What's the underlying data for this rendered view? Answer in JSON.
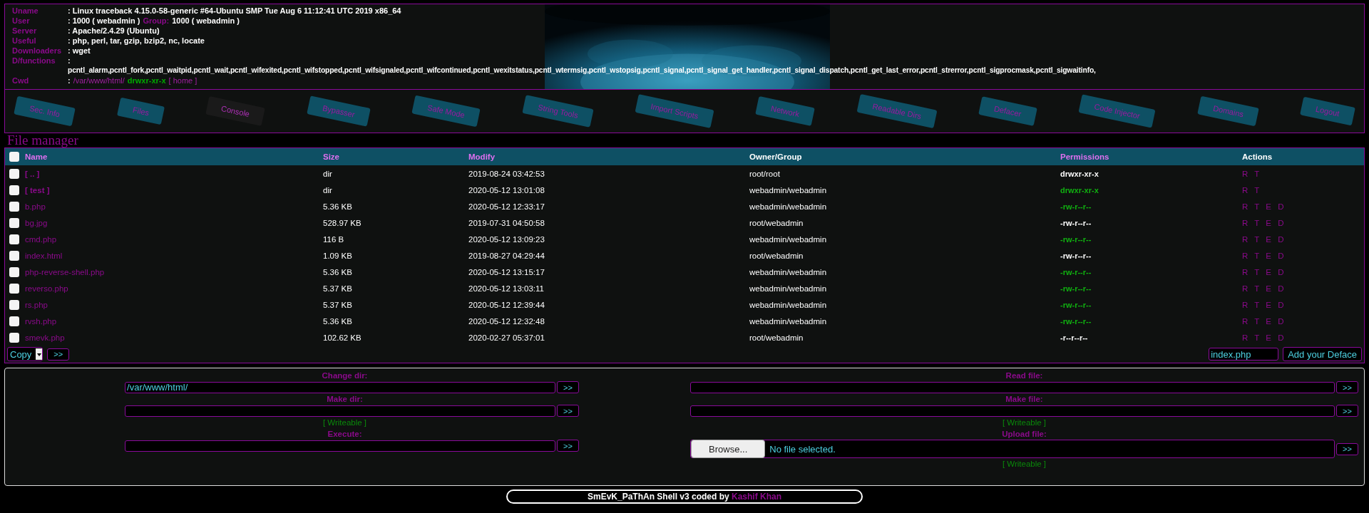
{
  "info": [
    {
      "label": "Uname",
      "value": ": Linux traceback 4.15.0-58-generic #64-Ubuntu SMP Tue Aug 6 11:12:41 UTC 2019 x86_64"
    },
    {
      "label": "User",
      "value": ": 1000 ( webadmin )",
      "group_label": "Group:",
      "group_value": "1000 ( webadmin )"
    },
    {
      "label": "Server",
      "value": ": Apache/2.4.29 (Ubuntu)"
    },
    {
      "label": "Useful",
      "value": ": php, perl, tar, gzip, bzip2, nc, locate"
    },
    {
      "label": "Downloaders",
      "value": ": wget"
    },
    {
      "label": "D/functions",
      "value": ":",
      "wrapped": "pcntl_alarm,pcntl_fork,pcntl_waitpid,pcntl_wait,pcntl_wifexited,pcntl_wifstopped,pcntl_wifsignaled,pcntl_wifcontinued,pcntl_wexitstatus,pcntl_wtermsig,pcntl_wstopsig,pcntl_signal,pcntl_signal_get_handler,pcntl_signal_dispatch,pcntl_get_last_error,pcntl_strerror,pcntl_sigprocmask,pcntl_sigwaitinfo,"
    }
  ],
  "cwd": {
    "label": "Cwd",
    "colon": ":",
    "path": "/var/www/html/",
    "perms": "drwxr-xr-x",
    "home": "[ home ]"
  },
  "tabs": [
    {
      "label": "Sec. Info",
      "selected": false
    },
    {
      "label": "Files",
      "selected": false
    },
    {
      "label": "Console",
      "selected": true
    },
    {
      "label": "Bypasser",
      "selected": false
    },
    {
      "label": "Safe Mode",
      "selected": false
    },
    {
      "label": "String Tools",
      "selected": false
    },
    {
      "label": "Import Scripts",
      "selected": false
    },
    {
      "label": "Network",
      "selected": false
    },
    {
      "label": "Readable Dirs",
      "selected": false
    },
    {
      "label": "Defacer",
      "selected": false
    },
    {
      "label": "Code Injector",
      "selected": false
    },
    {
      "label": "Domains",
      "selected": false
    },
    {
      "label": "Logout",
      "selected": false
    }
  ],
  "file_manager": {
    "title": "File manager",
    "columns": [
      "Name",
      "Size",
      "Modify",
      "Owner/Group",
      "Permissions",
      "Actions"
    ],
    "select_all_checked": false,
    "rows": [
      {
        "name": "[ .. ]",
        "kind": "dir",
        "size": "dir",
        "modify": "2019-08-24 03:42:53",
        "owner": "root/root",
        "perms": "drwxr-xr-x",
        "writable": false,
        "actions": "R T",
        "checked": false
      },
      {
        "name": "[ test ]",
        "kind": "dir",
        "size": "dir",
        "modify": "2020-05-12 13:01:08",
        "owner": "webadmin/webadmin",
        "perms": "drwxr-xr-x",
        "writable": true,
        "actions": "R T",
        "checked": false
      },
      {
        "name": "b.php",
        "kind": "file",
        "size": "5.36 KB",
        "modify": "2020-05-12 12:33:17",
        "owner": "webadmin/webadmin",
        "perms": "-rw-r--r--",
        "writable": true,
        "actions": "R T E D",
        "checked": false
      },
      {
        "name": "bg.jpg",
        "kind": "file",
        "size": "528.97 KB",
        "modify": "2019-07-31 04:50:58",
        "owner": "root/webadmin",
        "perms": "-rw-r--r--",
        "writable": false,
        "actions": "R T E D",
        "checked": false
      },
      {
        "name": "cmd.php",
        "kind": "file",
        "size": "116 B",
        "modify": "2020-05-12 13:09:23",
        "owner": "webadmin/webadmin",
        "perms": "-rw-r--r--",
        "writable": true,
        "actions": "R T E D",
        "checked": false
      },
      {
        "name": "index.html",
        "kind": "file",
        "size": "1.09 KB",
        "modify": "2019-08-27 04:29:44",
        "owner": "root/webadmin",
        "perms": "-rw-r--r--",
        "writable": false,
        "actions": "R T E D",
        "checked": false
      },
      {
        "name": "php-reverse-shell.php",
        "kind": "file",
        "size": "5.36 KB",
        "modify": "2020-05-12 13:15:17",
        "owner": "webadmin/webadmin",
        "perms": "-rw-r--r--",
        "writable": true,
        "actions": "R T E D",
        "checked": false
      },
      {
        "name": "reverso.php",
        "kind": "file",
        "size": "5.37 KB",
        "modify": "2020-05-12 13:03:11",
        "owner": "webadmin/webadmin",
        "perms": "-rw-r--r--",
        "writable": true,
        "actions": "R T E D",
        "checked": false
      },
      {
        "name": "rs.php",
        "kind": "file",
        "size": "5.37 KB",
        "modify": "2020-05-12 12:39:44",
        "owner": "webadmin/webadmin",
        "perms": "-rw-r--r--",
        "writable": true,
        "actions": "R T E D",
        "checked": false
      },
      {
        "name": "rvsh.php",
        "kind": "file",
        "size": "5.36 KB",
        "modify": "2020-05-12 12:32:48",
        "owner": "webadmin/webadmin",
        "perms": "-rw-r--r--",
        "writable": true,
        "actions": "R T E D",
        "checked": false
      },
      {
        "name": "smevk.php",
        "kind": "file",
        "size": "102.62 KB",
        "modify": "2020-02-27 05:37:01",
        "owner": "root/webadmin",
        "perms": "-r--r--r--",
        "writable": false,
        "actions": "R T E D",
        "checked": false
      }
    ],
    "action_select": "Copy",
    "go_button": ">>",
    "deface_value": "index.php",
    "deface_button": "Add your Deface"
  },
  "forms": [
    [
      {
        "label": "Change dir:",
        "kind": "text",
        "value": "/var/www/html/",
        "button": ">>"
      },
      {
        "label": "Make dir:",
        "kind": "text",
        "button": ">>",
        "note": "[ Writeable ]"
      },
      {
        "label": "Execute:",
        "kind": "text",
        "button": ">>"
      }
    ],
    [
      {
        "label": "Read file:",
        "kind": "text",
        "button": ">>"
      },
      {
        "label": "Make file:",
        "kind": "text",
        "button": ">>",
        "note": "[ Writeable ]"
      },
      {
        "label": "Upload file:",
        "kind": "file",
        "browse": "Browse...",
        "status": "No file selected.",
        "button": ">>",
        "note": "[ Writeable ]"
      }
    ]
  ],
  "footer": {
    "text": "SmEvK_PaThAn Shell v3 coded by",
    "author": "Kashif Khan"
  }
}
